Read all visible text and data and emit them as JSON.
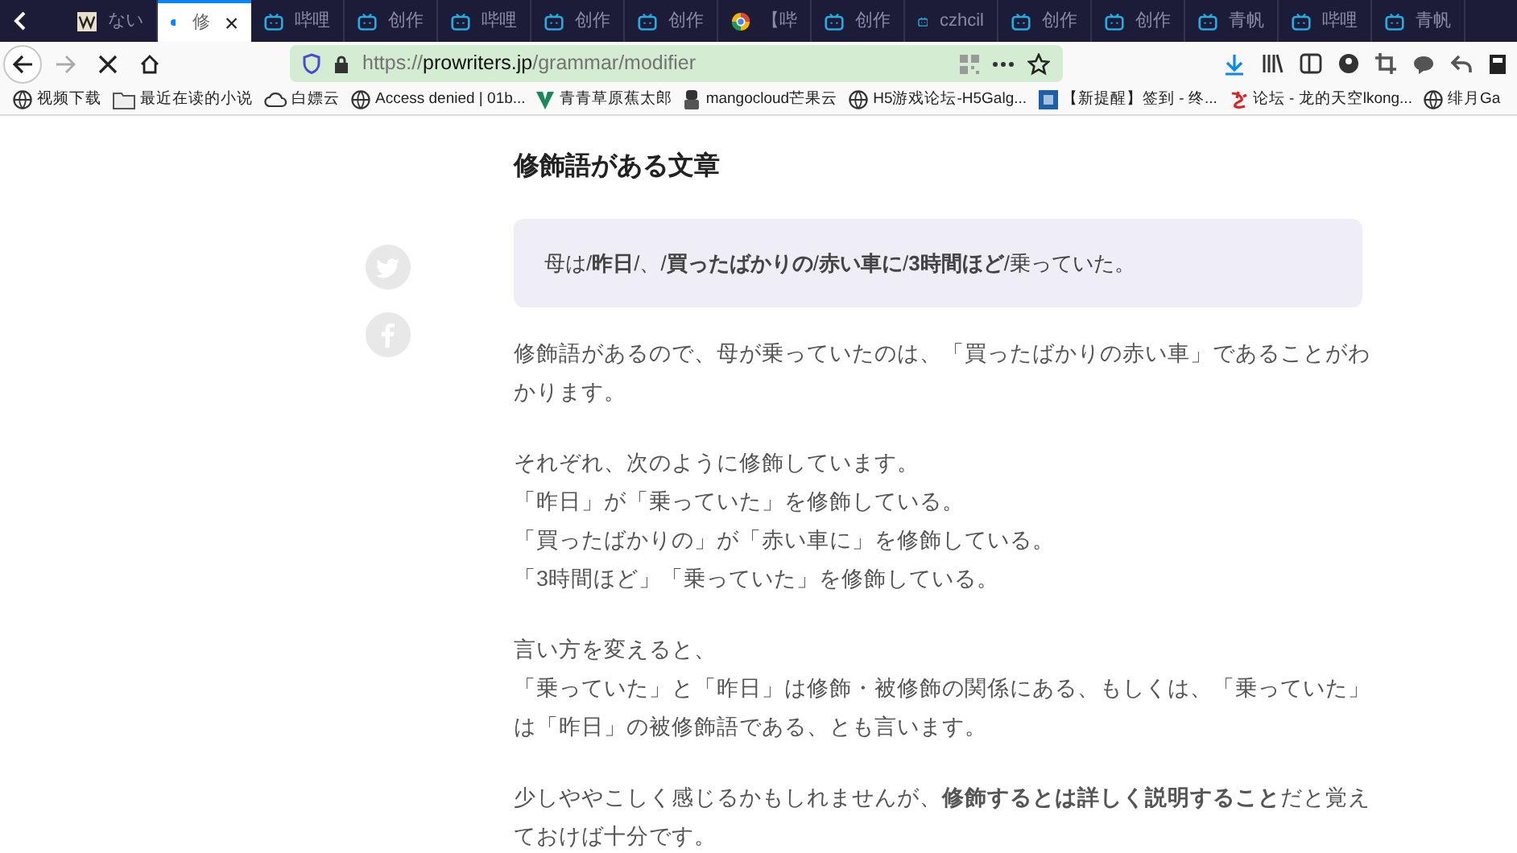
{
  "tabs": [
    {
      "label": "ない",
      "selected": false
    },
    {
      "label": "修",
      "selected": true
    },
    {
      "label": "哔哩",
      "selected": false
    },
    {
      "label": "创作",
      "selected": false
    },
    {
      "label": "哔哩",
      "selected": false
    },
    {
      "label": "创作",
      "selected": false
    },
    {
      "label": "创作",
      "selected": false
    },
    {
      "label": "【哔",
      "selected": false
    },
    {
      "label": "创作",
      "selected": false
    },
    {
      "label": "czhcil",
      "selected": false
    },
    {
      "label": "创作",
      "selected": false
    },
    {
      "label": "创作",
      "selected": false
    },
    {
      "label": "青帆",
      "selected": false
    },
    {
      "label": "哔哩",
      "selected": false
    },
    {
      "label": "青帆",
      "selected": false
    }
  ],
  "address_bar": {
    "scheme": "https://",
    "host": "prowriters.jp",
    "path": "/grammar/modifier"
  },
  "bookmarks": [
    {
      "label": "视频下载"
    },
    {
      "label": "最近在读的小说"
    },
    {
      "label": "白嫖云"
    },
    {
      "label": "Access denied | 01b..."
    },
    {
      "label": "青青草原蕉太郎"
    },
    {
      "label": "mangocloud芒果云"
    },
    {
      "label": "H5游戏论坛-H5Galg..."
    },
    {
      "label": "【新提醒】签到 - 终..."
    },
    {
      "label": "论坛 - 龙的天空lkong..."
    },
    {
      "label": "绯月Ga"
    }
  ],
  "article": {
    "heading": "修飾語がある文章",
    "example": "母は/**昨日**/、/**買ったばかりの**/**赤い車に**/**3時間ほど**/乗っていた。",
    "paragraphs": [
      [
        "修飾語があるので、母が乗っていたのは、「買ったばかりの赤い車」であることがわかります。"
      ],
      [
        "それぞれ、次のように修飾しています。",
        "「昨日」が「乗っていた」を修飾している。",
        "「買ったばかりの」が「赤い車に」を修飾している。",
        "「3時間ほど」「乗っていた」を修飾している。"
      ],
      [
        "言い方を変えると、",
        "「乗っていた」と「昨日」は修飾・被修飾の関係にある、もしくは、「乗っていた」は「昨日」の被修飾語である、とも言います。"
      ],
      [
        "少しややこしく感じるかもしれませんが、**修飾するとは詳しく説明すること**だと覚えておけば十分です。"
      ]
    ]
  }
}
